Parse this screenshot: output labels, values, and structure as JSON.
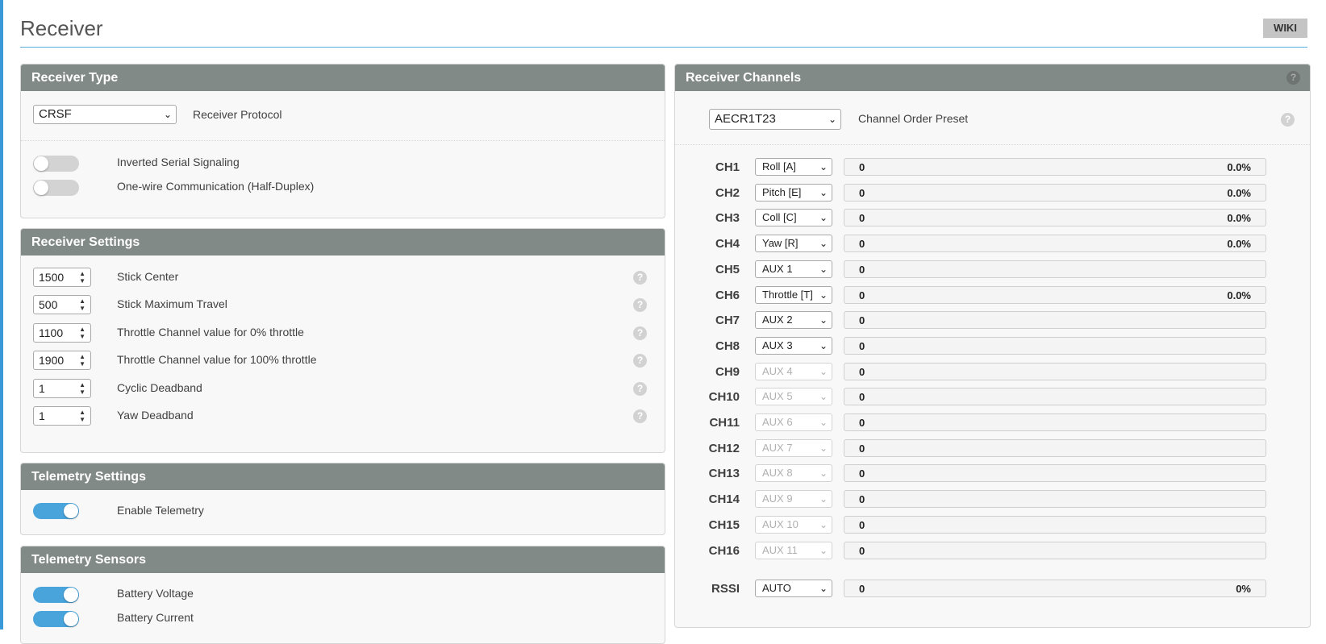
{
  "page": {
    "title": "Receiver",
    "wiki_label": "WIKI"
  },
  "receiver_type": {
    "title": "Receiver Type",
    "protocol_value": "CRSF",
    "protocol_label": "Receiver Protocol",
    "toggles": [
      {
        "label": "Inverted Serial Signaling",
        "on": false
      },
      {
        "label": "One-wire Communication (Half-Duplex)",
        "on": false
      }
    ]
  },
  "receiver_settings": {
    "title": "Receiver Settings",
    "fields": [
      {
        "value": "1500",
        "label": "Stick Center"
      },
      {
        "value": "500",
        "label": "Stick Maximum Travel"
      },
      {
        "value": "1100",
        "label": "Throttle Channel value for 0% throttle"
      },
      {
        "value": "1900",
        "label": "Throttle Channel value for 100% throttle"
      },
      {
        "value": "1",
        "label": "Cyclic Deadband"
      },
      {
        "value": "1",
        "label": "Yaw Deadband"
      }
    ]
  },
  "telemetry_settings": {
    "title": "Telemetry Settings",
    "toggles": [
      {
        "label": "Enable Telemetry",
        "on": true
      }
    ]
  },
  "telemetry_sensors": {
    "title": "Telemetry Sensors",
    "toggles": [
      {
        "label": "Battery Voltage",
        "on": true
      },
      {
        "label": "Battery Current",
        "on": true
      }
    ]
  },
  "receiver_channels": {
    "title": "Receiver Channels",
    "preset_value": "AECR1T23",
    "preset_label": "Channel Order Preset",
    "channels": [
      {
        "name": "CH1",
        "assign": "Roll [A]",
        "value": "0",
        "percent": "0.0%",
        "enabled": true
      },
      {
        "name": "CH2",
        "assign": "Pitch [E]",
        "value": "0",
        "percent": "0.0%",
        "enabled": true
      },
      {
        "name": "CH3",
        "assign": "Coll [C]",
        "value": "0",
        "percent": "0.0%",
        "enabled": true
      },
      {
        "name": "CH4",
        "assign": "Yaw [R]",
        "value": "0",
        "percent": "0.0%",
        "enabled": true
      },
      {
        "name": "CH5",
        "assign": "AUX 1",
        "value": "0",
        "percent": "",
        "enabled": true
      },
      {
        "name": "CH6",
        "assign": "Throttle [T]",
        "value": "0",
        "percent": "0.0%",
        "enabled": true
      },
      {
        "name": "CH7",
        "assign": "AUX 2",
        "value": "0",
        "percent": "",
        "enabled": true
      },
      {
        "name": "CH8",
        "assign": "AUX 3",
        "value": "0",
        "percent": "",
        "enabled": true
      },
      {
        "name": "CH9",
        "assign": "AUX 4",
        "value": "0",
        "percent": "",
        "enabled": false
      },
      {
        "name": "CH10",
        "assign": "AUX 5",
        "value": "0",
        "percent": "",
        "enabled": false
      },
      {
        "name": "CH11",
        "assign": "AUX 6",
        "value": "0",
        "percent": "",
        "enabled": false
      },
      {
        "name": "CH12",
        "assign": "AUX 7",
        "value": "0",
        "percent": "",
        "enabled": false
      },
      {
        "name": "CH13",
        "assign": "AUX 8",
        "value": "0",
        "percent": "",
        "enabled": false
      },
      {
        "name": "CH14",
        "assign": "AUX 9",
        "value": "0",
        "percent": "",
        "enabled": false
      },
      {
        "name": "CH15",
        "assign": "AUX 10",
        "value": "0",
        "percent": "",
        "enabled": false
      },
      {
        "name": "CH16",
        "assign": "AUX 11",
        "value": "0",
        "percent": "",
        "enabled": false
      }
    ],
    "rssi": {
      "name": "RSSI",
      "assign": "AUTO",
      "value": "0",
      "percent": "0%"
    }
  },
  "icons": {
    "help": "?",
    "chevron": "⌄"
  },
  "colors": {
    "panel_header": "#828a87",
    "toggle_on": "#4aa4dc",
    "accent_line": "#59aee0"
  }
}
